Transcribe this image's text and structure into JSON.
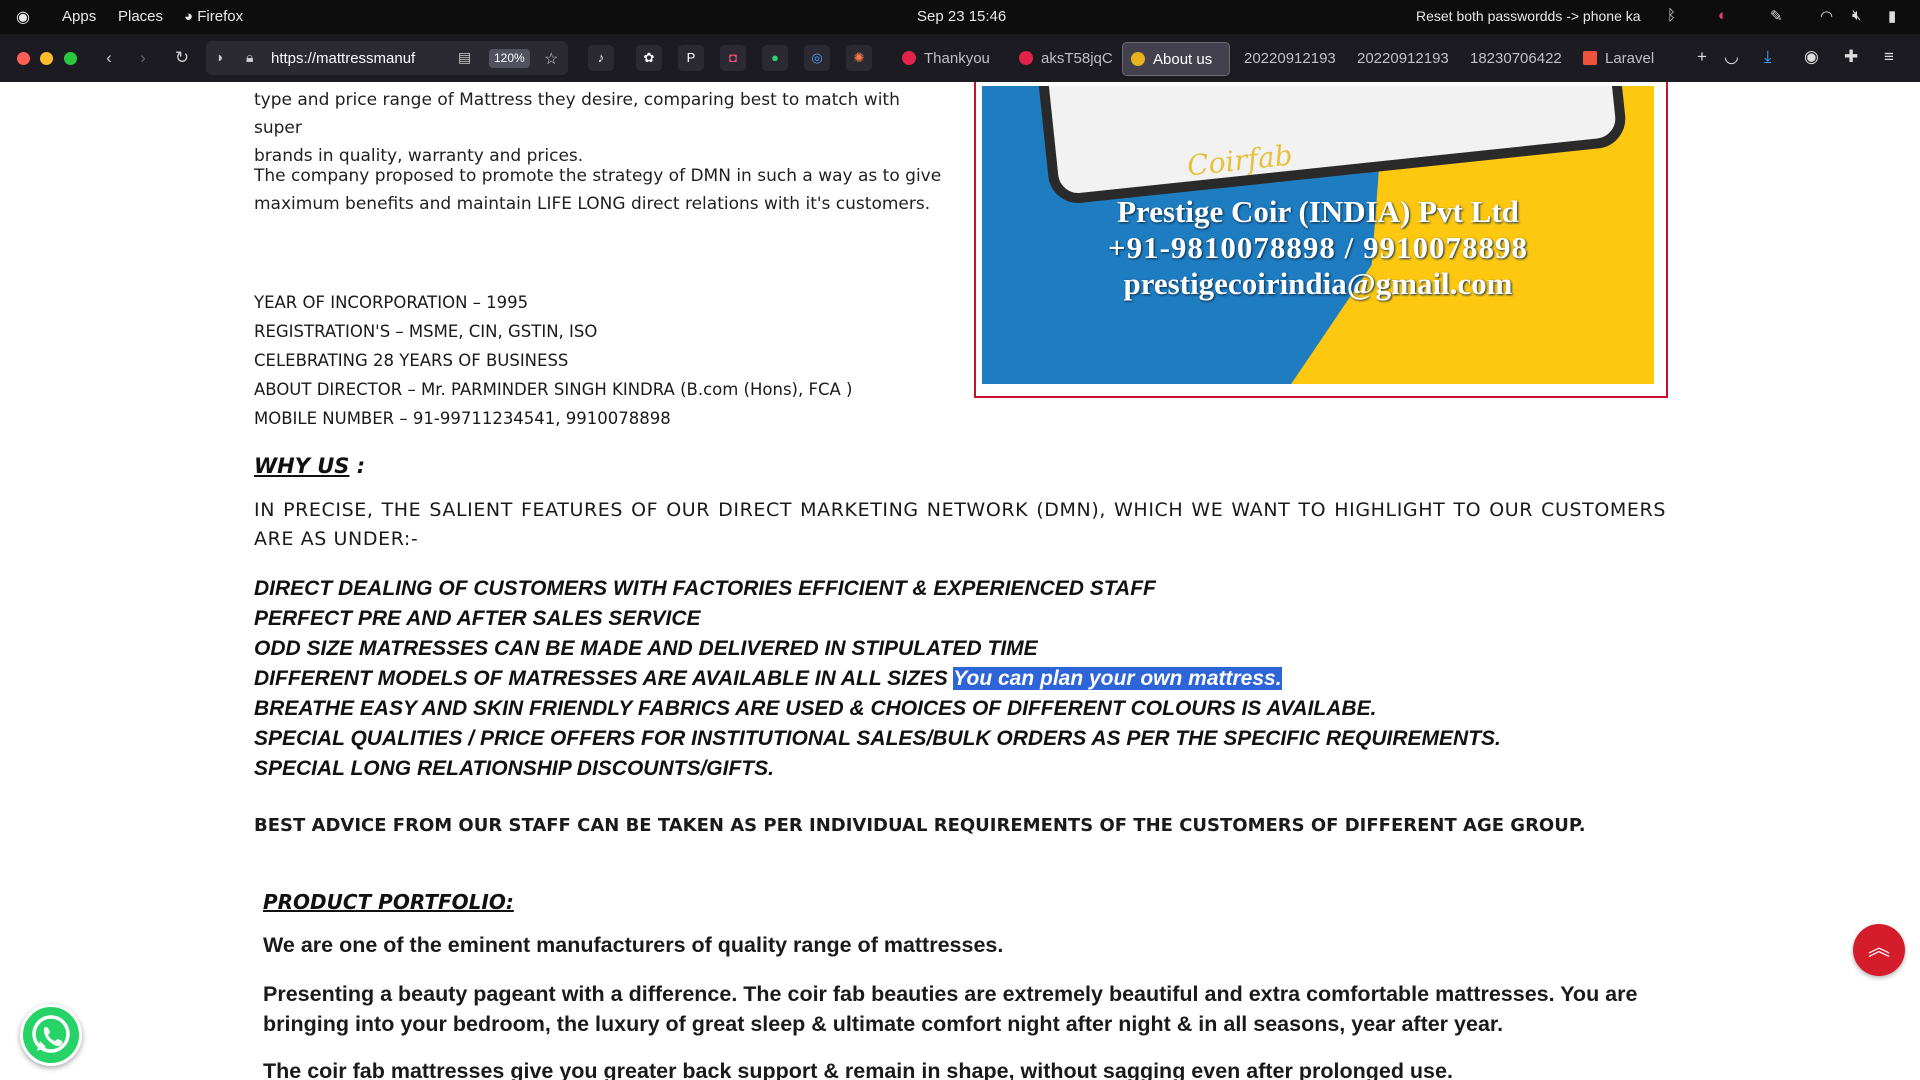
{
  "topbar": {
    "activities_icon": "circle-icon",
    "apps": "Apps",
    "places": "Places",
    "browser": "Firefox",
    "datetime": "Sep 23  15:46",
    "notification": "Reset both passwordds -> phone ka"
  },
  "browser": {
    "url": "https://mattressmanuf",
    "zoom": "120%",
    "tabs": [
      {
        "label": "Thankyou",
        "color": "#e0244a"
      },
      {
        "label": "aksT58jqC",
        "color": "#e0244a"
      },
      {
        "label": "About us",
        "color": "#e8b21e"
      },
      {
        "label": "20220912193",
        "color": "#6b6b6b"
      },
      {
        "label": "20220912193",
        "color": "#6b6b6b"
      },
      {
        "label": "18230706422",
        "color": "#6b6b6b"
      },
      {
        "label": "Laravel",
        "color": "#f0533d"
      }
    ]
  },
  "page": {
    "intro_line1": "type and price range of Mattress they desire, comparing best to match with super",
    "intro_line2": "brands in quality, warranty and prices.",
    "strategy_line1": "The company proposed to promote the strategy of DMN in such a way as to give",
    "strategy_line2": "maximum benefits and maintain LIFE LONG direct relations with it's customers.",
    "facts": [
      "YEAR OF INCORPORATION – 1995",
      "REGISTRATION'S – MSME, CIN, GSTIN, ISO",
      "CELEBRATING 28 YEARS OF BUSINESS",
      "ABOUT DIRECTOR – Mr. PARMINDER SINGH KINDRA (B.com (Hons), FCA )",
      "MOBILE NUMBER – 91-99711234541, 9910078898"
    ],
    "why_us": "WHY US",
    "why_colon": " :",
    "precise": "IN PRECISE, THE SALIENT FEATURES OF OUR DIRECT MARKETING NETWORK (DMN), WHICH WE WANT TO HIGHLIGHT TO OUR CUSTOMERS ARE AS UNDER:-",
    "features": [
      "DIRECT DEALING OF CUSTOMERS WITH FACTORIES EFFICIENT & EXPERIENCED STAFF",
      "PERFECT PRE AND AFTER SALES SERVICE",
      "ODD SIZE MATRESSES CAN BE MADE AND DELIVERED IN STIPULATED TIME",
      "DIFFERENT MODELS OF MATRESSES ARE AVAILABLE IN ALL SIZES ",
      "BREATHE EASY AND SKIN FRIENDLY FABRICS ARE USED & CHOICES OF DIFFERENT COLOURS IS AVAILABE.",
      "SPECIAL QUALITIES / PRICE OFFERS FOR INSTITUTIONAL SALES/BULK ORDERS AS PER THE SPECIFIC REQUIREMENTS.",
      "SPECIAL LONG RELATIONSHIP DISCOUNTS/GIFTS."
    ],
    "highlighted": "You can plan your own mattress.",
    "advice": "BEST ADVICE FROM OUR STAFF CAN BE TAKEN AS PER INDIVIDUAL REQUIREMENTS OF THE CUSTOMERS OF DIFFERENT AGE GROUP.",
    "portfolio_title": "PRODUCT PORTFOLIO:",
    "portfolio_p1": "We are one of the eminent manufacturers of quality range of mattresses.",
    "portfolio_p2_line1": "Presenting a beauty pageant with a difference. The coir fab beauties are extremely beautiful and extra comfortable mattresses. You are",
    "portfolio_p2_line2": "bringing into your bedroom, the luxury of great sleep & ultimate comfort night after night & in all seasons, year after year.",
    "portfolio_p3": "The coir fab mattresses give you greater back support & remain in shape, without sagging even after prolonged use."
  },
  "banner": {
    "brand": "Coirfab",
    "company": "Prestige Coir (INDIA) Pvt Ltd",
    "phones": "+91-9810078898 / 9910078898",
    "email": "prestigecoirindia@gmail.com"
  },
  "colors": {
    "highlight": "#2d64d8",
    "accent_red": "#d51c2a",
    "whatsapp": "#25d366",
    "banner_blue": "#1e7cc0",
    "banner_yellow": "#fdc80f"
  }
}
